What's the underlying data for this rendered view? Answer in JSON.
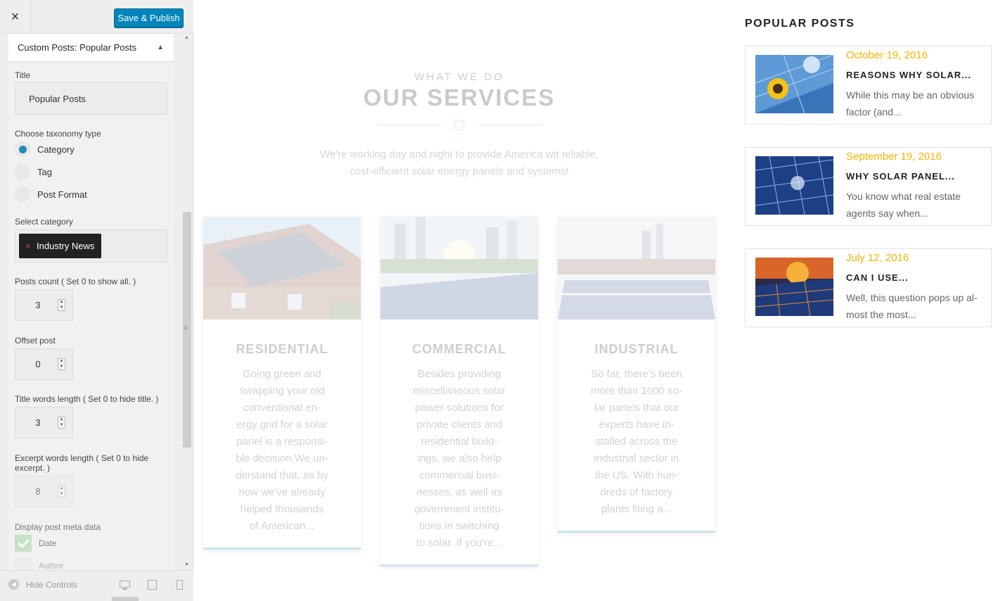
{
  "header": {
    "close_icon": "×",
    "publish_label": "Save & Publish"
  },
  "section": {
    "prefix": "Custom Posts:",
    "name": "Popular Posts"
  },
  "form": {
    "title_label": "Title",
    "title_value": "Popular Posts",
    "taxonomy_label": "Choose taxonomy type",
    "taxonomy_options": [
      "Category",
      "Tag",
      "Post Format"
    ],
    "taxonomy_selected": "Category",
    "category_label": "Select category",
    "category_selected": "Industry News",
    "posts_count_label": "Posts count ( Set 0 to show all. )",
    "posts_count_value": "3",
    "offset_label": "Offset post",
    "offset_value": "0",
    "title_words_label": "Title words length ( Set 0 to hide title. )",
    "title_words_value": "3",
    "excerpt_words_label": "Excerpt words length ( Set 0 to hide excerpt. )",
    "excerpt_words_value": "8",
    "meta_label": "Display post meta data",
    "meta_options": [
      {
        "label": "Date",
        "checked": true
      },
      {
        "label": "Author",
        "checked": false
      }
    ]
  },
  "footer": {
    "hide_controls_label": "Hide Controls",
    "devices": [
      "desktop-icon",
      "tablet-icon",
      "mobile-icon"
    ]
  },
  "services": {
    "eyebrow": "WHAT WE DO",
    "title": "OUR SERVICES",
    "subtitle_line1": "We're working day and night to provide America wit reliable,",
    "subtitle_line2": "cost-efficient solar energy panels and systems!",
    "cards": [
      {
        "title": "RESIDENTIAL",
        "lines": [
          "Going green and",
          "swapping your old",
          "conventional en-",
          "ergy grid for a solar",
          "panel is a responsi-",
          "ble decision.We un-",
          "derstand that, as by",
          "now we've already",
          "helped thousands",
          "of American..."
        ]
      },
      {
        "title": "COMMERCIAL",
        "lines": [
          "Besides providing",
          "miscellaneous solar",
          "power solutions for",
          "private clients and",
          "residential build-",
          "ings, we also help",
          "commercial busi-",
          "nesses, as well as",
          "government institu-",
          "tions in switching",
          "to solar. If you're..."
        ]
      },
      {
        "title": "INDUSTRIAL",
        "lines": [
          "So far, there's been",
          "more than 1000 so-",
          "lar panels that our",
          "experts have in-",
          "stalled across the",
          "industrial sector in",
          "the US. With hun-",
          "dreds of factory",
          "plants filing a..."
        ]
      }
    ]
  },
  "widget": {
    "title": "POPULAR POSTS",
    "posts": [
      {
        "date": "October 19, 2016",
        "title": "REASONS WHY SOLAR...",
        "excerpt_line1": "While this may be an obvious",
        "excerpt_line2": "factor (and..."
      },
      {
        "date": "September 19, 2016",
        "title": "WHY SOLAR PANEL...",
        "excerpt_line1": "You know what real estate",
        "excerpt_line2": "agents say when..."
      },
      {
        "date": "July 12, 2016",
        "title": "CAN I USE...",
        "excerpt_line1": "Well, this question pops up al-",
        "excerpt_line2": "most the most..."
      }
    ]
  },
  "colors": {
    "accent_blue": "#0085ba",
    "date_yellow": "#f4b400",
    "radio_blue": "#1e8cbe"
  }
}
